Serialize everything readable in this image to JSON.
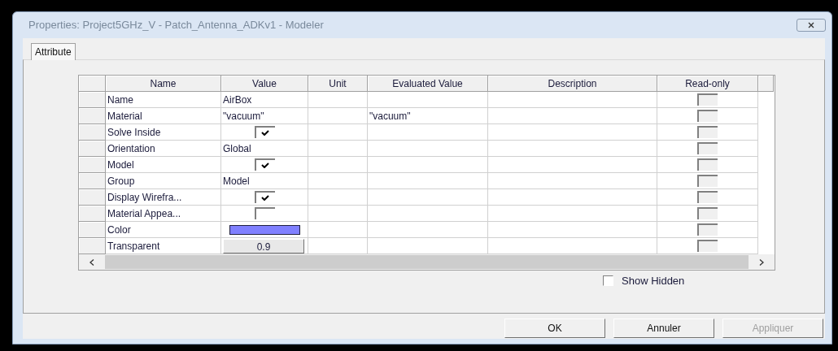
{
  "window": {
    "title": "Properties: Project5GHz_V - Patch_Antenna_ADKv1 - Modeler"
  },
  "tabs": [
    {
      "label": "Attribute",
      "selected": true
    }
  ],
  "table": {
    "columns": [
      "Name",
      "Value",
      "Unit",
      "Evaluated Value",
      "Description",
      "Read-only"
    ],
    "rows": [
      {
        "name": "Name",
        "kind": "text",
        "value": "AirBox",
        "read_only": false
      },
      {
        "name": "Material",
        "kind": "text",
        "value": "\"vacuum\"",
        "evaluated_value": "\"vacuum\"",
        "read_only": false
      },
      {
        "name": "Solve Inside",
        "kind": "checkbox",
        "checked": true,
        "read_only": false
      },
      {
        "name": "Orientation",
        "kind": "text",
        "value": "Global",
        "read_only": false
      },
      {
        "name": "Model",
        "kind": "checkbox",
        "checked": true,
        "read_only": false
      },
      {
        "name": "Group",
        "kind": "text",
        "value": "Model",
        "read_only": false
      },
      {
        "name": "Display Wirefra...",
        "kind": "checkbox",
        "checked": true,
        "read_only": false
      },
      {
        "name": "Material Appea...",
        "kind": "checkbox",
        "checked": false,
        "read_only": false
      },
      {
        "name": "Color",
        "kind": "color",
        "color": "#8080ff",
        "read_only": false
      },
      {
        "name": "Transparent",
        "kind": "button",
        "value": "0.9",
        "read_only": false
      }
    ]
  },
  "show_hidden": {
    "label": "Show Hidden",
    "checked": false
  },
  "buttons": [
    {
      "label": "OK",
      "disabled": false
    },
    {
      "label": "Annuler",
      "disabled": false
    },
    {
      "label": "Appliquer",
      "disabled": true
    }
  ]
}
